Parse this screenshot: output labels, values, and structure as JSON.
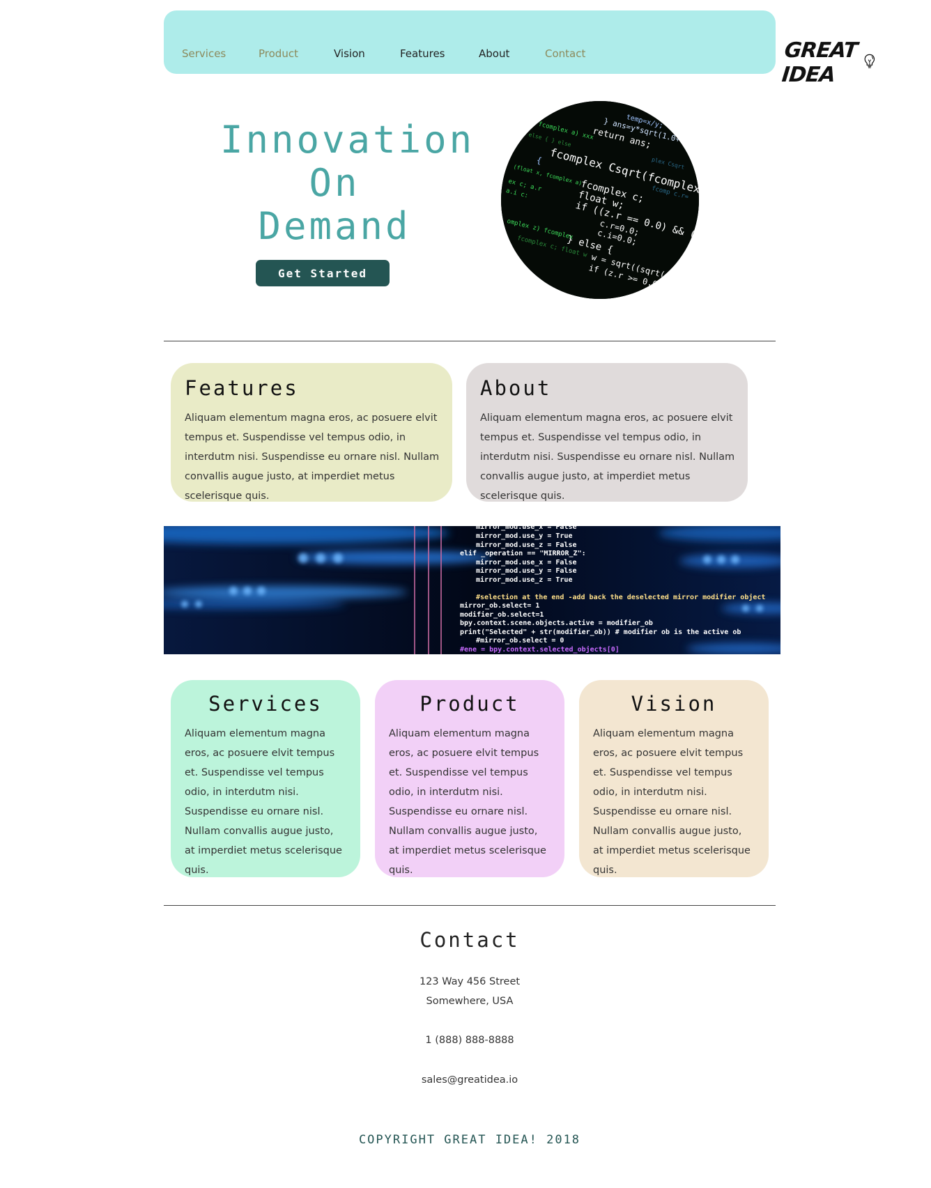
{
  "nav": {
    "items": [
      {
        "label": "Services",
        "style": "muted"
      },
      {
        "label": "Product",
        "style": "muted"
      },
      {
        "label": "Vision",
        "style": "dark"
      },
      {
        "label": "Features",
        "style": "dark"
      },
      {
        "label": "About",
        "style": "dark"
      },
      {
        "label": "Contact",
        "style": "muted"
      }
    ],
    "logo_text": "GREAT IDEA",
    "logo_icon": "lightbulb-icon",
    "background": "#aeecea"
  },
  "hero": {
    "title_lines": [
      "Innovation",
      "On",
      "Demand"
    ],
    "cta_label": "Get Started",
    "image": "code-screen-photo"
  },
  "cards_top": [
    {
      "title": "Features",
      "body": "Aliquam elementum magna eros, ac posuere elvit tempus et. Suspendisse vel tempus odio, in interdutm nisi. Suspendisse eu ornare nisl. Nullam convallis augue justo, at imperdiet metus scelerisque quis.",
      "color": "#e9ebc7"
    },
    {
      "title": "About",
      "body": "Aliquam elementum magna eros, ac posuere elvit tempus et. Suspendisse vel tempus odio, in interdutm nisi. Suspendisse eu ornare nisl. Nullam convallis augue justo, at imperdiet metus scelerisque quis.",
      "color": "#e0dbdb"
    }
  ],
  "banner": {
    "image": "code-banner-photo"
  },
  "cards_bottom": [
    {
      "title": "Services",
      "body": "Aliquam elementum magna eros, ac posuere elvit tempus et. Suspendisse vel tempus odio, in interdutm nisi. Suspendisse eu ornare nisl. Nullam convallis augue justo, at imperdiet metus scelerisque quis.",
      "color": "#bcf4db"
    },
    {
      "title": "Product",
      "body": "Aliquam elementum magna eros, ac posuere elvit tempus et. Suspendisse vel tempus odio, in interdutm nisi. Suspendisse eu ornare nisl. Nullam convallis augue justo, at imperdiet metus scelerisque quis.",
      "color": "#f2d0f7"
    },
    {
      "title": "Vision",
      "body": "Aliquam elementum magna eros, ac posuere elvit tempus et. Suspendisse vel tempus odio, in interdutm nisi. Suspendisse eu ornare nisl. Nullam convallis augue justo, at imperdiet metus scelerisque quis.",
      "color": "#f3e6d1"
    }
  ],
  "contact": {
    "title": "Contact",
    "address_line1": "123 Way 456 Street",
    "address_line2": "Somewhere, USA",
    "phone": "1 (888) 888-8888",
    "email": "sales@greatidea.io"
  },
  "footer": {
    "copyright": "COPYRIGHT GREAT IDEA! 2018"
  },
  "colors": {
    "accent_teal": "#4aa6a4",
    "button_dark_teal": "#245553"
  }
}
